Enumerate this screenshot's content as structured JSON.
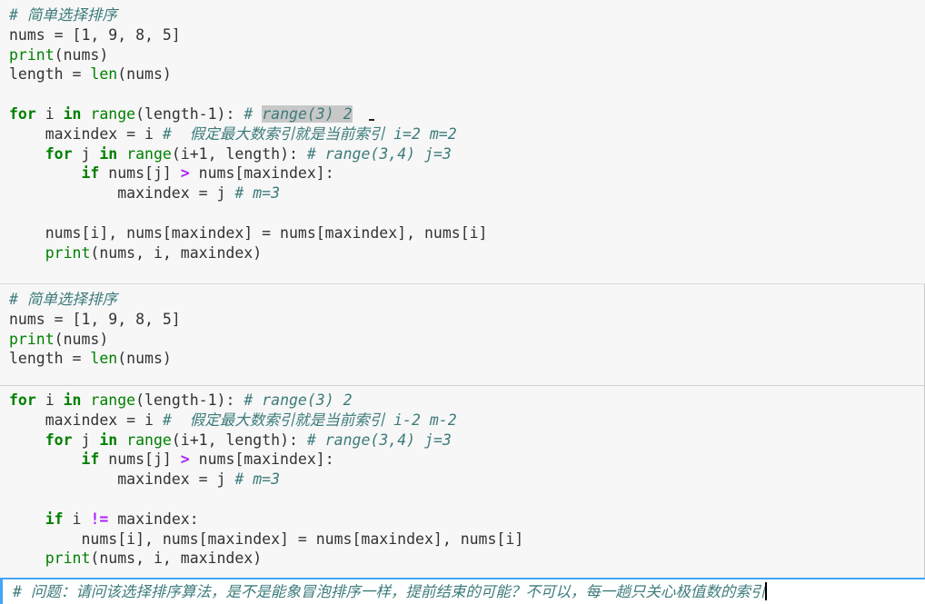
{
  "cells": [
    {
      "id": "cell-1",
      "lines": [
        [
          {
            "t": "cm",
            "v": "# 简单选择排序"
          }
        ],
        [
          {
            "t": "p",
            "v": "nums = [1, 9, 8, 5]"
          }
        ],
        [
          {
            "t": "fn",
            "v": "print"
          },
          {
            "t": "p",
            "v": "(nums)"
          }
        ],
        [
          {
            "t": "p",
            "v": "length = "
          },
          {
            "t": "fn",
            "v": "len"
          },
          {
            "t": "p",
            "v": "(nums)"
          }
        ],
        [],
        [
          {
            "t": "kw",
            "v": "for"
          },
          {
            "t": "p",
            "v": " i "
          },
          {
            "t": "kw",
            "v": "in"
          },
          {
            "t": "p",
            "v": " "
          },
          {
            "t": "fn",
            "v": "range"
          },
          {
            "t": "p",
            "v": "(length-1): "
          },
          {
            "t": "cm",
            "v": "# "
          },
          {
            "t": "cmhl",
            "v": "range(3) 2"
          },
          {
            "t": "cursor",
            "v": ""
          }
        ],
        [
          {
            "t": "p",
            "v": "    maxindex = i "
          },
          {
            "t": "cm",
            "v": "#  假定最大数索引就是当前索引 i=2 m=2"
          }
        ],
        [
          {
            "t": "p",
            "v": "    "
          },
          {
            "t": "kw",
            "v": "for"
          },
          {
            "t": "p",
            "v": " j "
          },
          {
            "t": "kw",
            "v": "in"
          },
          {
            "t": "p",
            "v": " "
          },
          {
            "t": "fn",
            "v": "range"
          },
          {
            "t": "p",
            "v": "(i+1, length): "
          },
          {
            "t": "cm",
            "v": "# range(3,4) j=3"
          }
        ],
        [
          {
            "t": "p",
            "v": "        "
          },
          {
            "t": "kw",
            "v": "if"
          },
          {
            "t": "p",
            "v": " nums[j] "
          },
          {
            "t": "op",
            "v": ">"
          },
          {
            "t": "p",
            "v": " nums[maxindex]:"
          }
        ],
        [
          {
            "t": "p",
            "v": "            maxindex = j "
          },
          {
            "t": "cm",
            "v": "# m=3"
          }
        ],
        [],
        [
          {
            "t": "p",
            "v": "    nums[i], nums[maxindex] = nums[maxindex], nums[i]"
          }
        ],
        [
          {
            "t": "p",
            "v": "    "
          },
          {
            "t": "fn",
            "v": "print"
          },
          {
            "t": "p",
            "v": "(nums, i, maxindex)"
          }
        ]
      ]
    },
    {
      "id": "cell-2",
      "lines": [
        [
          {
            "t": "cm",
            "v": "# 简单选择排序"
          }
        ],
        [
          {
            "t": "p",
            "v": "nums = [1, 9, 8, 5]"
          }
        ],
        [
          {
            "t": "fn",
            "v": "print"
          },
          {
            "t": "p",
            "v": "(nums)"
          }
        ],
        [
          {
            "t": "p",
            "v": "length = "
          },
          {
            "t": "fn",
            "v": "len"
          },
          {
            "t": "p",
            "v": "(nums)"
          }
        ]
      ]
    },
    {
      "id": "cell-2b",
      "lines": [
        [
          {
            "t": "kw",
            "v": "for"
          },
          {
            "t": "p",
            "v": " i "
          },
          {
            "t": "kw",
            "v": "in"
          },
          {
            "t": "p",
            "v": " "
          },
          {
            "t": "fn",
            "v": "range"
          },
          {
            "t": "p",
            "v": "(length-1): "
          },
          {
            "t": "cm",
            "v": "# range(3) 2"
          }
        ],
        [
          {
            "t": "p",
            "v": "    maxindex = i "
          },
          {
            "t": "cm",
            "v": "#  假定最大数索引就是当前索引 i-2 m-2"
          }
        ],
        [
          {
            "t": "p",
            "v": "    "
          },
          {
            "t": "kw",
            "v": "for"
          },
          {
            "t": "p",
            "v": " j "
          },
          {
            "t": "kw",
            "v": "in"
          },
          {
            "t": "p",
            "v": " "
          },
          {
            "t": "fn",
            "v": "range"
          },
          {
            "t": "p",
            "v": "(i+1, length): "
          },
          {
            "t": "cm",
            "v": "# range(3,4) j=3"
          }
        ],
        [
          {
            "t": "p",
            "v": "        "
          },
          {
            "t": "kw",
            "v": "if"
          },
          {
            "t": "p",
            "v": " nums[j] "
          },
          {
            "t": "op",
            "v": ">"
          },
          {
            "t": "p",
            "v": " nums[maxindex]:"
          }
        ],
        [
          {
            "t": "p",
            "v": "            maxindex = j "
          },
          {
            "t": "cm",
            "v": "# m=3"
          }
        ],
        [],
        [
          {
            "t": "p",
            "v": "    "
          },
          {
            "t": "kw",
            "v": "if"
          },
          {
            "t": "p",
            "v": " i "
          },
          {
            "t": "op",
            "v": "!="
          },
          {
            "t": "p",
            "v": " maxindex:"
          }
        ],
        [
          {
            "t": "p",
            "v": "        nums[i], nums[maxindex] = nums[maxindex], nums[i]"
          }
        ],
        [
          {
            "t": "p",
            "v": "    "
          },
          {
            "t": "fn",
            "v": "print"
          },
          {
            "t": "p",
            "v": "(nums, i, maxindex)"
          }
        ]
      ]
    },
    {
      "id": "cell-3",
      "lines": [
        [
          {
            "t": "cm",
            "v": "# 问题：请问该选择排序算法，是不是能象冒泡排序一样，提前结束的可能？不可以，每一趟只关心极值数的索引"
          },
          {
            "t": "textcursor",
            "v": ""
          }
        ]
      ]
    }
  ]
}
